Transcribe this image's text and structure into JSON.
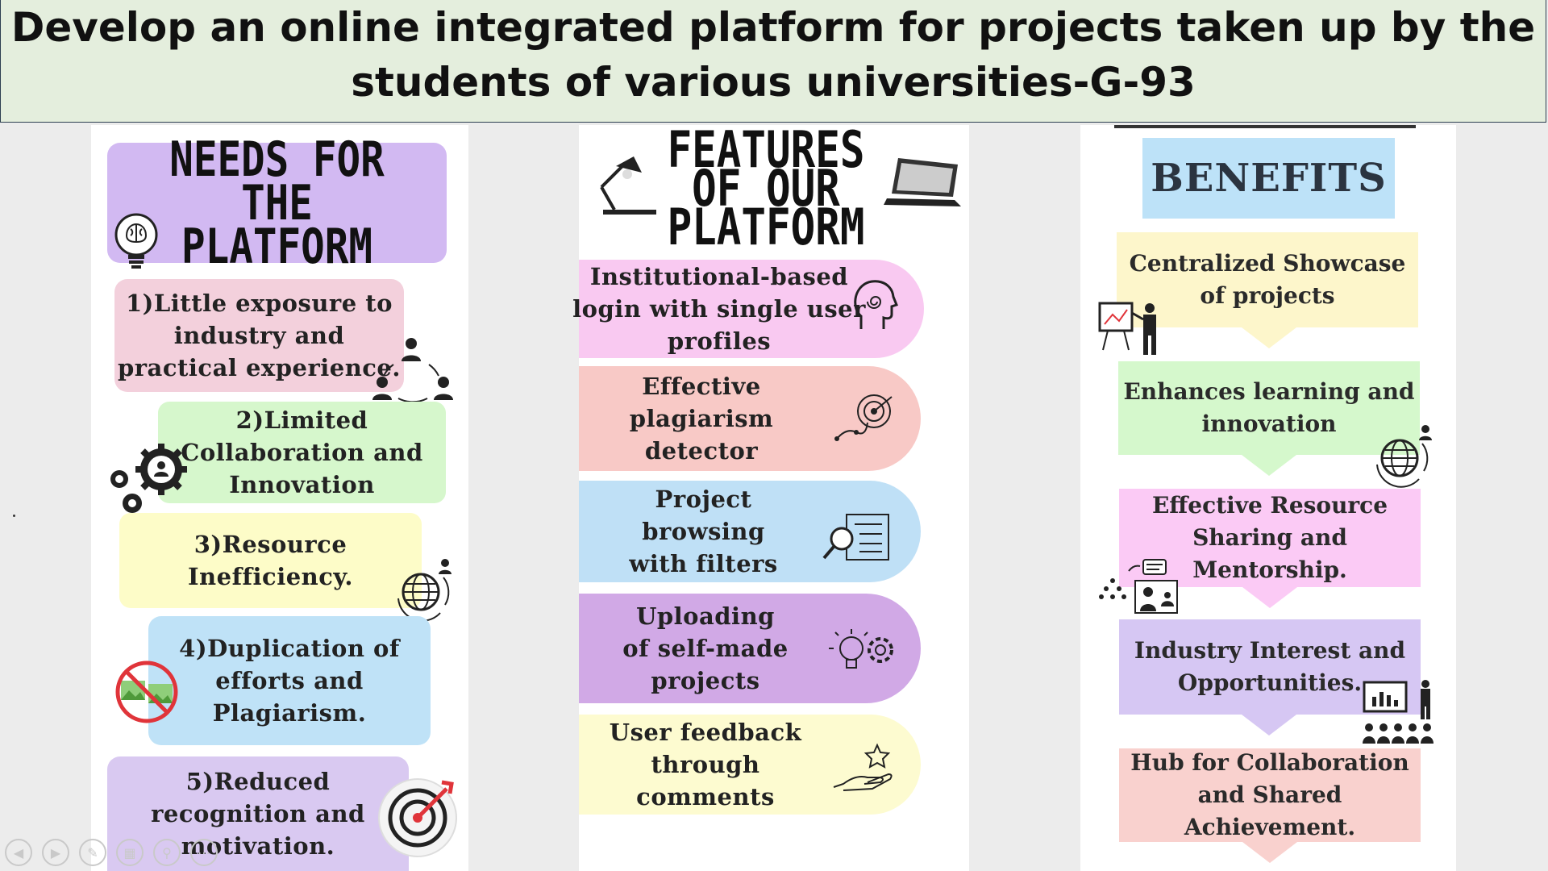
{
  "slide": {
    "title_line1": "Develop an online integrated platform for projects taken up by the",
    "title_line2": "students of various universities-G-93"
  },
  "needs": {
    "heading_line1": "NEEDS FOR THE",
    "heading_line2": "PLATFORM",
    "items": [
      {
        "lines": [
          "1)Little exposure to",
          "industry and",
          "practical experience."
        ],
        "color": "#f3d0dc"
      },
      {
        "lines": [
          "2)Limited",
          "Collaboration and",
          "Innovation"
        ],
        "color": "#d6f7cc"
      },
      {
        "lines": [
          "3)Resource",
          "Inefficiency."
        ],
        "color": "#fdfcc8"
      },
      {
        "lines": [
          "4)Duplication of",
          "efforts and",
          "Plagiarism."
        ],
        "color": "#bfe2f7"
      },
      {
        "lines": [
          "5)Reduced",
          "recognition and",
          "motivation."
        ],
        "color": "#d9c9f1"
      }
    ]
  },
  "features": {
    "heading_line1": "FEATURES",
    "heading_line2": "OF OUR",
    "heading_line3": "PLATFORM",
    "items": [
      {
        "lines": [
          "Institutional-based",
          "login with single user",
          "profiles"
        ],
        "color": "#f9c9f1",
        "icon": "brain-head-icon"
      },
      {
        "lines": [
          "Effective",
          "plagiarism",
          "detector"
        ],
        "color": "#f8c9c6",
        "icon": "target-path-icon"
      },
      {
        "lines": [
          "Project",
          "browsing",
          "with filters"
        ],
        "color": "#bfe0f6",
        "icon": "search-document-icon"
      },
      {
        "lines": [
          "Uploading",
          "of self-made",
          "projects"
        ],
        "color": "#d1a9e6",
        "icon": "idea-gear-icon"
      },
      {
        "lines": [
          "User feedback",
          "through",
          "comments"
        ],
        "color": "#fdfbd0",
        "icon": "hand-star-icon"
      }
    ]
  },
  "benefits": {
    "heading": "BENEFITS",
    "heading_color": "#bde2f8",
    "items": [
      {
        "lines": [
          "Centralized Showcase",
          "of projects"
        ],
        "color": "#fdf6cb"
      },
      {
        "lines": [
          "Enhances learning and",
          "innovation"
        ],
        "color": "#d5f8cc"
      },
      {
        "lines": [
          "Effective Resource",
          "Sharing and",
          "Mentorship."
        ],
        "color": "#fbcaf5"
      },
      {
        "lines": [
          "Industry Interest and",
          "Opportunities."
        ],
        "color": "#d6c7f3"
      },
      {
        "lines": [
          "Hub for Collaboration",
          "and Shared",
          "Achievement."
        ],
        "color": "#f9d1ce"
      }
    ]
  }
}
